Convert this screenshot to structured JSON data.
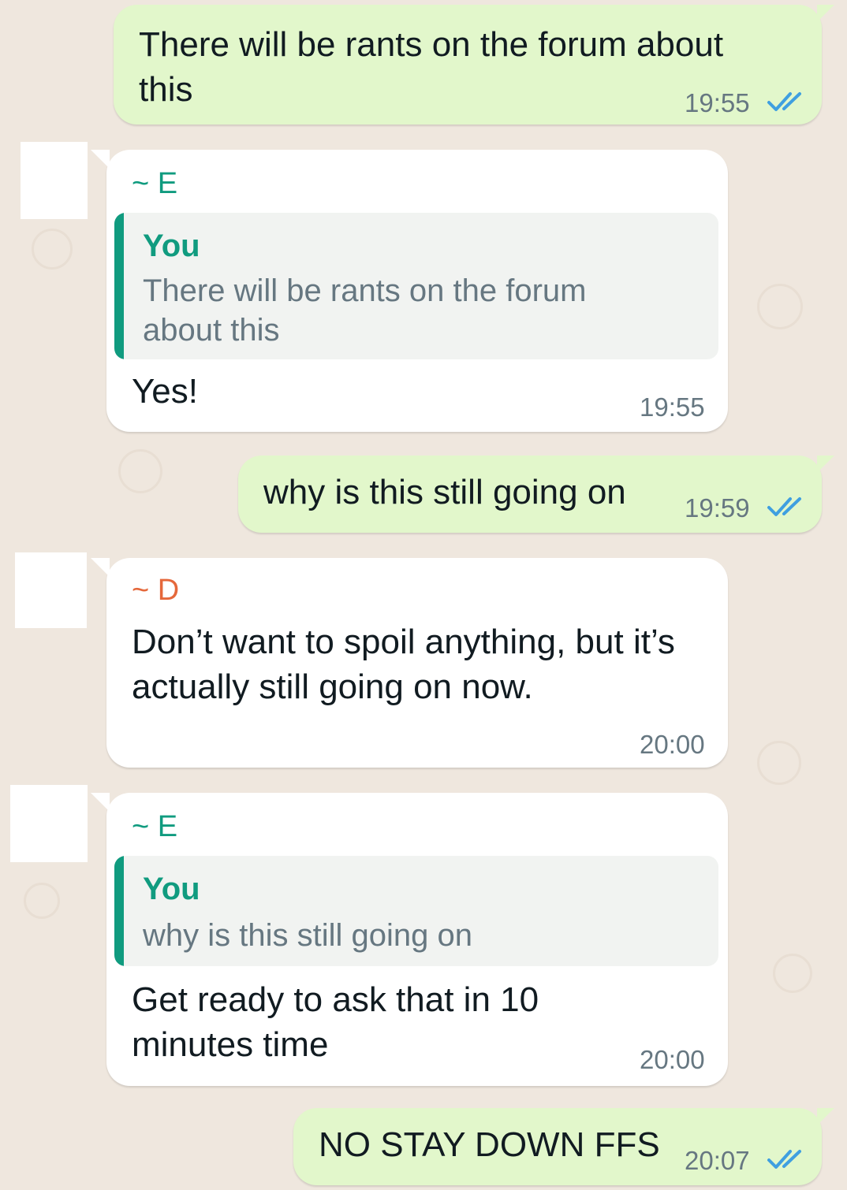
{
  "accent_colors": {
    "sender_e": "#109b7f",
    "sender_d": "#e5683b",
    "outgoing_bubble": "#e2f7cb",
    "read_ticks": "#3f9fe0"
  },
  "messages": [
    {
      "direction": "outgoing",
      "text": "There will be rants on the forum about this",
      "time": "19:55",
      "status_icon": "double-check-read-icon"
    },
    {
      "direction": "incoming",
      "sender": "~ E",
      "quote": {
        "name": "You",
        "text": "There will be rants on the forum about this"
      },
      "text": "Yes!",
      "time": "19:55"
    },
    {
      "direction": "outgoing",
      "text": "why is this still going on",
      "time": "19:59",
      "status_icon": "double-check-read-icon"
    },
    {
      "direction": "incoming",
      "sender": "~ D",
      "text": "Don’t want to spoil anything, but it’s actually still going on now.",
      "time": "20:00"
    },
    {
      "direction": "incoming",
      "sender": "~ E",
      "quote": {
        "name": "You",
        "text": "why is this still going on"
      },
      "text": "Get ready to ask that in 10 minutes time",
      "time": "20:00"
    },
    {
      "direction": "outgoing",
      "text": "NO STAY DOWN FFS",
      "time": "20:07",
      "status_icon": "double-check-read-icon"
    }
  ]
}
